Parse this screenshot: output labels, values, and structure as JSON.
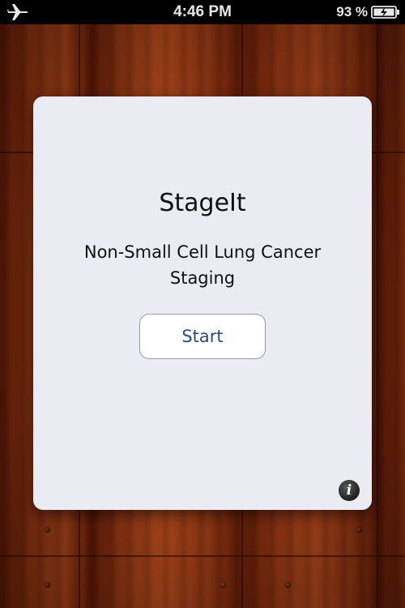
{
  "status_bar": {
    "time": "4:46 PM",
    "battery_percent": "93 %",
    "airplane_icon": "airplane-icon",
    "battery_icon": "battery-charging-icon"
  },
  "app": {
    "title": "StageIt",
    "subtitle": "Non-Small Cell Lung Cancer Staging",
    "start_label": "Start",
    "info_label": "i"
  },
  "colors": {
    "card_background": "#ebebf4",
    "button_text": "#2f4a74",
    "wood_primary": "#8a3210"
  }
}
